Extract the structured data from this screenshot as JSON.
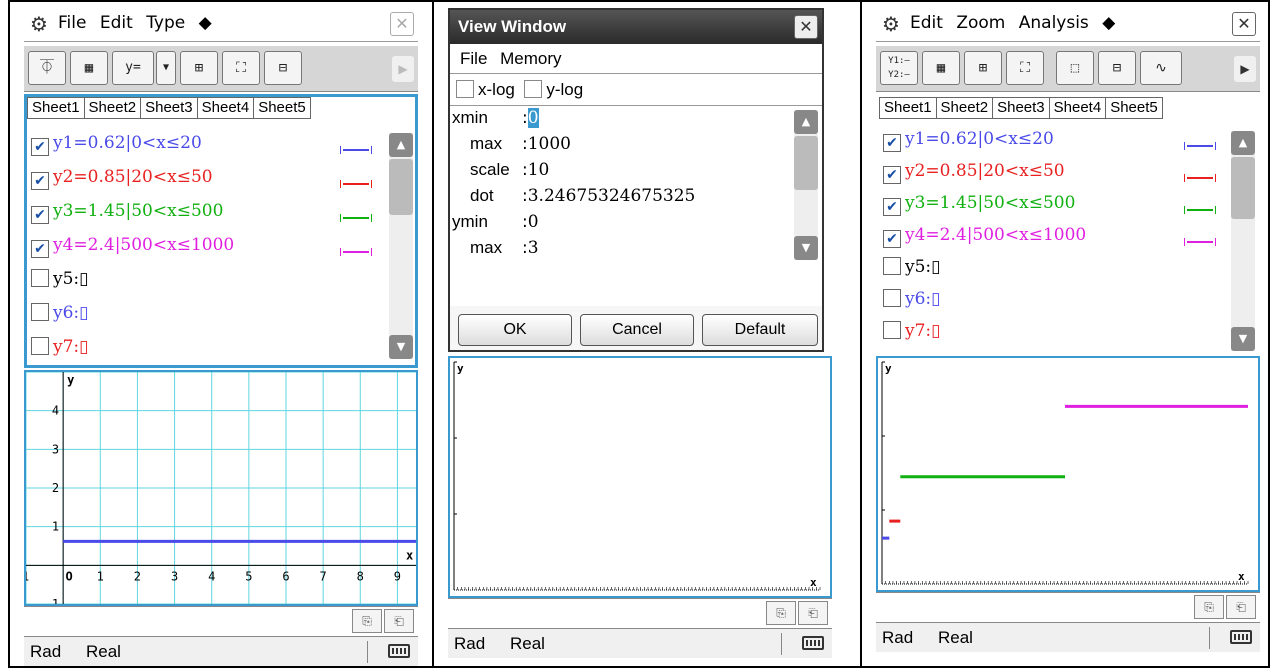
{
  "panel1": {
    "menu": [
      "File",
      "Edit",
      "Type",
      "◆"
    ],
    "toolbar": {
      "y_eq": "y=",
      "dropdown": "▼"
    },
    "tabs": [
      "Sheet1",
      "Sheet2",
      "Sheet3",
      "Sheet4",
      "Sheet5"
    ],
    "functions": [
      {
        "label": "y1=0.62|0<x≤20",
        "checked": true,
        "color": "#4a4ae8"
      },
      {
        "label": "y2=0.85|20<x≤50",
        "checked": true,
        "color": "#e82020"
      },
      {
        "label": "y3=1.45|50<x≤500",
        "checked": true,
        "color": "#10b010"
      },
      {
        "label": "y4=2.4|500<x≤1000",
        "checked": true,
        "color": "#e020e0"
      },
      {
        "label": "y5:▯",
        "checked": false,
        "color": "#000000"
      },
      {
        "label": "y6:▯",
        "checked": false,
        "color": "#4a4ae8"
      },
      {
        "label": "y7:▯",
        "checked": false,
        "color": "#e82020"
      }
    ],
    "graph": {
      "y_label": "y",
      "x_label": "x",
      "y_ticks": [
        "4",
        "3",
        "2",
        "1",
        "-1"
      ],
      "x_ticks": [
        "-1",
        "O",
        "1",
        "2",
        "3",
        "4",
        "5",
        "6",
        "7",
        "8",
        "9"
      ]
    },
    "status": {
      "angle": "Rad",
      "mode": "Real"
    }
  },
  "panel2": {
    "dialog_title": "View Window",
    "menu": [
      "File",
      "Memory"
    ],
    "log_options": [
      "x-log",
      "y-log"
    ],
    "fields": [
      {
        "label": "xmin",
        "value": "0"
      },
      {
        "label": "max",
        "value": "1000"
      },
      {
        "label": "scale",
        "value": "10"
      },
      {
        "label": "dot",
        "value": "3.24675324675325"
      },
      {
        "label": "ymin",
        "value": "0"
      },
      {
        "label": "max",
        "value": "3"
      }
    ],
    "buttons": {
      "ok": "OK",
      "cancel": "Cancel",
      "default": "Default"
    },
    "graph": {
      "y_label": "y",
      "x_label": "x"
    },
    "status": {
      "angle": "Rad",
      "mode": "Real"
    }
  },
  "panel3": {
    "menu": [
      "Edit",
      "Zoom",
      "Analysis",
      "◆"
    ],
    "tabs": [
      "Sheet1",
      "Sheet2",
      "Sheet3",
      "Sheet4",
      "Sheet5"
    ],
    "functions": [
      {
        "label": "y1=0.62|0<x≤20",
        "checked": true,
        "color": "#4a4ae8"
      },
      {
        "label": "y2=0.85|20<x≤50",
        "checked": true,
        "color": "#e82020"
      },
      {
        "label": "y3=1.45|50<x≤500",
        "checked": true,
        "color": "#10b010"
      },
      {
        "label": "y4=2.4|500<x≤1000",
        "checked": true,
        "color": "#e020e0"
      },
      {
        "label": "y5:▯",
        "checked": false,
        "color": "#000000"
      },
      {
        "label": "y6:▯",
        "checked": false,
        "color": "#4a4ae8"
      },
      {
        "label": "y7:▯",
        "checked": false,
        "color": "#e82020"
      }
    ],
    "graph": {
      "y_label": "y",
      "x_label": "x"
    },
    "status": {
      "angle": "Rad",
      "mode": "Real"
    }
  },
  "chart_data": [
    {
      "type": "line",
      "xlim": [
        -1,
        9.5
      ],
      "ylim": [
        -1,
        5
      ],
      "grid": true,
      "series": [
        {
          "name": "y1",
          "color": "#4a4ae8",
          "segments": [
            {
              "x": [
                0,
                20
              ],
              "y": [
                0.62,
                0.62
              ]
            }
          ]
        },
        {
          "name": "y2",
          "color": "#e82020",
          "segments": [
            {
              "x": [
                20,
                50
              ],
              "y": [
                0.85,
                0.85
              ]
            }
          ]
        },
        {
          "name": "y3",
          "color": "#10b010",
          "segments": [
            {
              "x": [
                50,
                500
              ],
              "y": [
                1.45,
                1.45
              ]
            }
          ]
        },
        {
          "name": "y4",
          "color": "#e020e0",
          "segments": [
            {
              "x": [
                500,
                1000
              ],
              "y": [
                2.4,
                2.4
              ]
            }
          ]
        }
      ]
    },
    {
      "type": "line",
      "xlim": [
        0,
        1000
      ],
      "ylim": [
        0,
        3
      ],
      "grid": false,
      "series": [
        {
          "name": "y1",
          "color": "#4a4ae8",
          "segments": [
            {
              "x": [
                0,
                20
              ],
              "y": [
                0.62,
                0.62
              ]
            }
          ]
        },
        {
          "name": "y2",
          "color": "#e82020",
          "segments": [
            {
              "x": [
                20,
                50
              ],
              "y": [
                0.85,
                0.85
              ]
            }
          ]
        },
        {
          "name": "y3",
          "color": "#10b010",
          "segments": [
            {
              "x": [
                50,
                500
              ],
              "y": [
                1.45,
                1.45
              ]
            }
          ]
        },
        {
          "name": "y4",
          "color": "#e020e0",
          "segments": [
            {
              "x": [
                500,
                1000
              ],
              "y": [
                2.4,
                2.4
              ]
            }
          ]
        }
      ]
    }
  ]
}
